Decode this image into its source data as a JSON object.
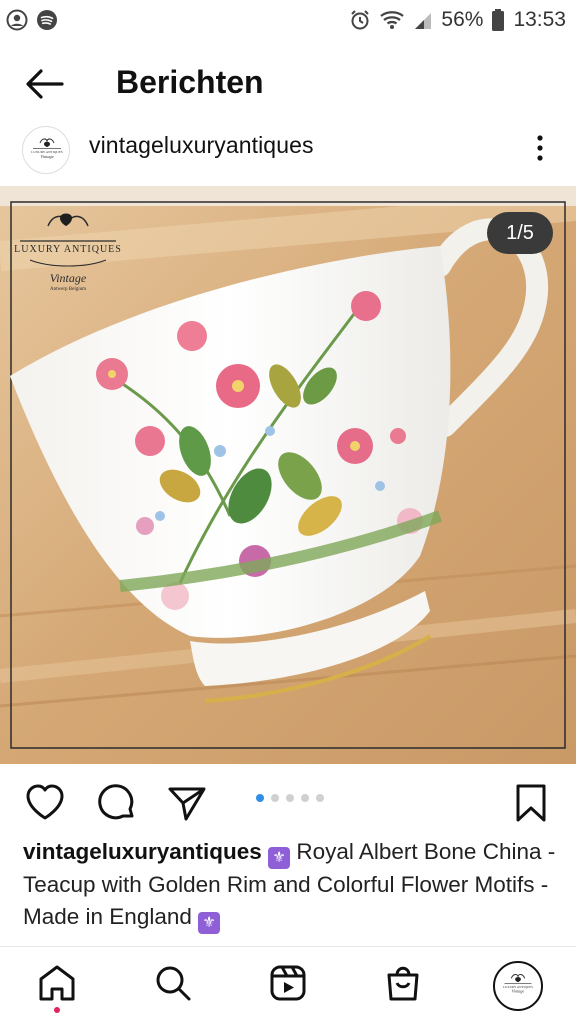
{
  "status_bar": {
    "battery_percent": "56%",
    "time": "13:53",
    "left_icons": [
      "account-circle-icon",
      "spotify-icon"
    ],
    "right_icons": [
      "alarm-icon",
      "wifi-icon",
      "signal-icon",
      "battery-icon"
    ]
  },
  "header": {
    "title": "Berichten"
  },
  "post": {
    "username": "vintageluxuryantiques",
    "image_counter": "1/5",
    "carousel": {
      "count": 5,
      "active_index": 0
    },
    "watermark": {
      "line1": "LUXURY ANTIQUES",
      "line2": "Vintage",
      "line3": "Antwerp Belgium"
    },
    "caption": {
      "username": "vintageluxuryantiques",
      "text": " Royal Albert Bone China - Teacup with Golden Rim and Colorful Flower Motifs - Made in England "
    }
  },
  "avatar_logo": {
    "line1": "LUXURY ANTIQUES",
    "line2": "Vintage"
  },
  "colors": {
    "accent_dot": "#2f8ee6",
    "notification": "#e0245e",
    "counter_bg": "#3a3a3a"
  },
  "nav": [
    "home-icon",
    "search-icon",
    "reels-icon",
    "shop-icon",
    "profile-avatar"
  ]
}
